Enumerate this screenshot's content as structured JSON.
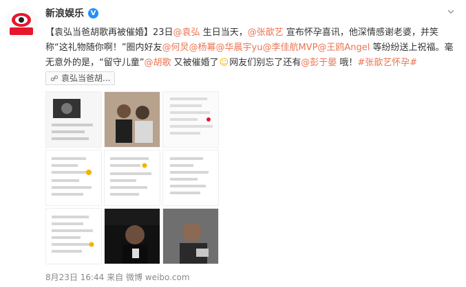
{
  "account": {
    "name": "新浪娱乐",
    "avatar_text": "新浪娱乐"
  },
  "post": {
    "text_parts": [
      {
        "t": "【袁弘当爸胡歌再被催婚】23日",
        "link": false
      },
      {
        "t": "@袁弘",
        "link": true
      },
      {
        "t": " 生日当天，",
        "link": false
      },
      {
        "t": "@张歆艺",
        "link": true
      },
      {
        "t": " 宣布怀孕喜讯，他深情感谢老婆，并笑称“这礼物随你啊！”圈内好友",
        "link": false
      },
      {
        "t": "@何炅",
        "link": true
      },
      {
        "t": "@杨幂",
        "link": true
      },
      {
        "t": "@华晨宇yu",
        "link": true
      },
      {
        "t": "@李佳航MVP",
        "link": true
      },
      {
        "t": "@王鸥Angel",
        "link": true
      },
      {
        "t": " 等纷纷送上祝福。毫无意外的是，“留守儿童”",
        "link": false
      },
      {
        "t": "@胡歌",
        "link": true
      },
      {
        "t": " 又被催婚了",
        "link": false
      },
      {
        "t": "网友们别忘了还有",
        "link": false
      },
      {
        "t": "@彭于晏",
        "link": true
      },
      {
        "t": " 哦！",
        "link": false
      },
      {
        "t": "#张歆艺怀孕#",
        "link": true
      }
    ],
    "topic_chip": "袁弘当爸胡..."
  },
  "footer": {
    "time": "8月23日 16:44",
    "source_prefix": "来自",
    "source": "微博 weibo.com"
  },
  "colors": {
    "link": "#eb7350",
    "brand_red": "#e6162d"
  },
  "icons": {
    "verified": "verified-icon",
    "chevron": "chevron-down-icon",
    "link_chip": "link-icon",
    "emoji": "emoji-icon"
  }
}
